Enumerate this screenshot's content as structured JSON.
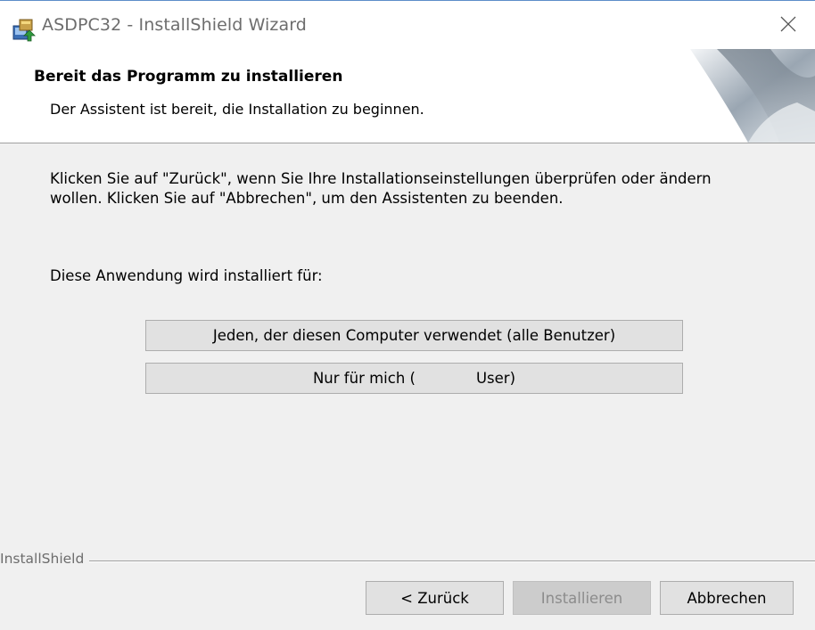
{
  "window": {
    "title": "ASDPC32 - InstallShield Wizard",
    "close_glyph": "✕"
  },
  "header": {
    "title": "Bereit das Programm zu installieren",
    "subtitle": "Der Assistent ist bereit, die Installation zu beginnen."
  },
  "body": {
    "line1": "Klicken Sie auf \"Zurück\", wenn Sie Ihre Installationseinstellungen überprüfen oder ändern",
    "line2": "wollen. Klicken Sie auf \"Abbrechen\", um den Assistenten zu beenden.",
    "prompt": "Diese Anwendung wird installiert für:"
  },
  "choices": {
    "all_users": "Jeden, der diesen Computer verwendet (alle Benutzer)",
    "only_me_prefix": "Nur für mich (",
    "only_me_suffix": "User)"
  },
  "footer": {
    "brand": "InstallShield",
    "back": "< Zurück",
    "install": "Installieren",
    "cancel": "Abbrechen"
  }
}
